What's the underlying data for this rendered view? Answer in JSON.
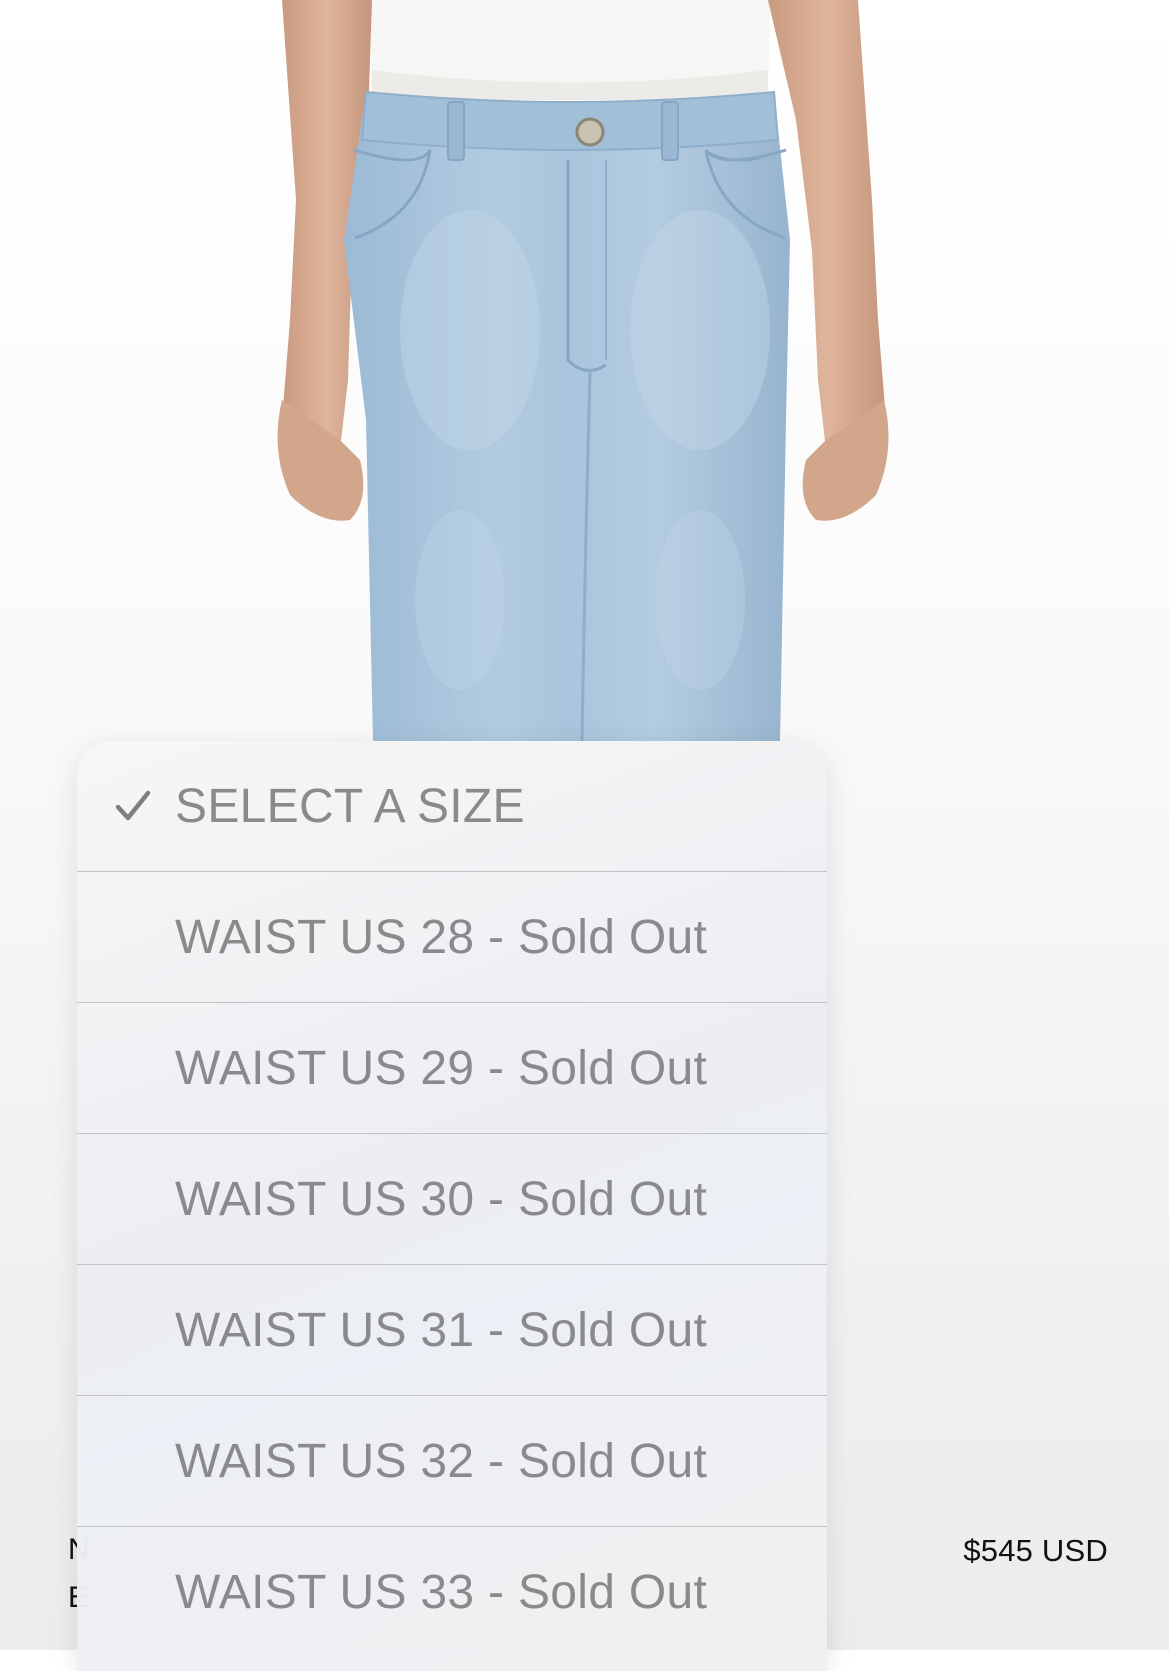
{
  "product": {
    "name_fragment": "N",
    "brand_fragment": "E",
    "price": "$545 USD"
  },
  "size_menu": {
    "selected_index": 0,
    "options": [
      {
        "label": "SELECT A SIZE"
      },
      {
        "label": "WAIST US 28 - Sold Out"
      },
      {
        "label": "WAIST US 29 - Sold Out"
      },
      {
        "label": "WAIST US 30 - Sold Out"
      },
      {
        "label": "WAIST US 31 - Sold Out"
      },
      {
        "label": "WAIST US 32 - Sold Out"
      },
      {
        "label": "WAIST US 33 - Sold Out"
      }
    ]
  },
  "icons": {
    "check": "check-icon"
  },
  "colors": {
    "denim": "#a9c4dc",
    "option_text": "#8a8a8d",
    "price_text": "#111111"
  }
}
